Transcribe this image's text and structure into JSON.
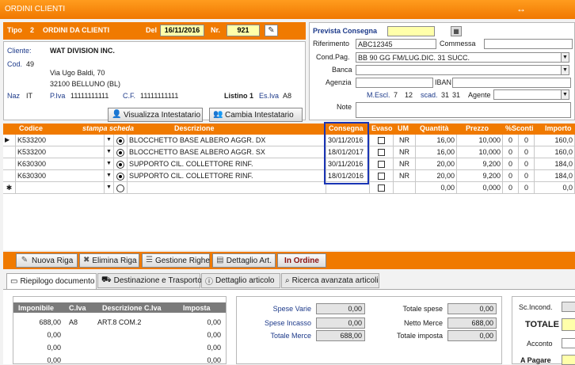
{
  "window": {
    "title": "ORDINI CLIENTI",
    "control_icon": "↔"
  },
  "header": {
    "tipo_label": "Tipo",
    "tipo_value": "2",
    "tipo_desc": "ORDINI DA CLIENTI",
    "del_label": "Del",
    "del_value": "16/11/2016",
    "nr_label": "Nr.",
    "nr_value": "921"
  },
  "cliente": {
    "cliente_label": "Cliente:",
    "name": "WAT DIVISION INC.",
    "cod_label": "Cod.",
    "cod_value": "49",
    "address1": "Via Ugo Baldi, 70",
    "address2": "32100 BELLUNO (BL)",
    "naz_label": "Naz",
    "naz_value": "IT",
    "piva_label": "P.Iva",
    "piva_value": "11111111111",
    "cf_label": "C.F.",
    "cf_value": "11111111111",
    "listino_label": "Listino",
    "listino_value": "1",
    "esiva_label": "Es.Iva",
    "esiva_value": "A8",
    "btn_visualizza": "Visualizza Intestatario",
    "btn_cambia": "Cambia Intestatario"
  },
  "right_panel": {
    "prevista_label": "Prevista Consegna",
    "prevista_value": "",
    "riferimento_label": "Riferimento",
    "riferimento_value": "ABC12345",
    "commessa_label": "Commessa",
    "commessa_value": "",
    "condpag_label": "Cond.Pag.",
    "condpag_value": "BB 90 GG FM/LUG.DIC. 31 SUCC.",
    "banca_label": "Banca",
    "banca_value": "",
    "agenzia_label": "Agenzia",
    "agenzia_value": "",
    "iban_label": "IBAN",
    "iban_value": "",
    "mescl_label": "M.Escl.",
    "mescl_value1": "7",
    "mescl_value2": "12",
    "scad_label": "scad.",
    "scad_value1": "31",
    "scad_value2": "31",
    "agente_label": "Agente",
    "agente_value": "",
    "note_label": "Note",
    "note_value": ""
  },
  "grid": {
    "columns": [
      "Codice",
      "stampa scheda",
      "Descrizione",
      "Consegna",
      "Evaso",
      "UM",
      "Quantità",
      "Prezzo",
      "%Sconti",
      "Importo"
    ],
    "rows": [
      {
        "codice": "K533200",
        "descrizione": "BLOCCHETTO BASE ALBERO AGGR. DX",
        "consegna": "30/11/2016",
        "um": "NR",
        "quantita": "16,00",
        "prezzo": "10,000",
        "sc1": "0",
        "sc2": "0",
        "importo": "160,0"
      },
      {
        "codice": "K533200",
        "descrizione": "BLOCCHETTO BASE ALBERO AGGR. SX",
        "consegna": "18/01/2017",
        "um": "NR",
        "quantita": "16,00",
        "prezzo": "10,000",
        "sc1": "0",
        "sc2": "0",
        "importo": "160,0"
      },
      {
        "codice": "K630300",
        "descrizione": "SUPPORTO CIL. COLLETTORE RINF.",
        "consegna": "30/11/2016",
        "um": "NR",
        "quantita": "20,00",
        "prezzo": "9,200",
        "sc1": "0",
        "sc2": "0",
        "importo": "184,0"
      },
      {
        "codice": "K630300",
        "descrizione": "SUPPORTO CIL. COLLETTORE RINF.",
        "consegna": "18/01/2016",
        "um": "NR",
        "quantita": "20,00",
        "prezzo": "9,200",
        "sc1": "0",
        "sc2": "0",
        "importo": "184,0"
      }
    ],
    "new_row": {
      "marker": "✱",
      "quantita": "0,00",
      "prezzo": "0,000",
      "sc1": "0",
      "sc2": "0",
      "importo": "0,0"
    },
    "current_marker": "▶"
  },
  "actions": {
    "nuova_riga": "Nuova Riga",
    "elimina_riga": "Elimina Riga",
    "gestione_righe": "Gestione Righe",
    "dettaglio_art": "Dettaglio Art.",
    "in_ordine": "In Ordine"
  },
  "tabs": [
    "Riepilogo documento",
    "Destinazione e Trasporto",
    "Dettaglio articolo",
    "Ricerca avanzata articoli"
  ],
  "iva_table": {
    "columns": [
      "Imponibile",
      "C.Iva",
      "Descrizione C.Iva",
      "Imposta"
    ],
    "rows": [
      {
        "imponibile": "688,00",
        "civa": "A8",
        "descrizione": "ART.8 COM.2",
        "imposta": "0,00"
      },
      {
        "imponibile": "0,00",
        "civa": "",
        "descrizione": "",
        "imposta": "0,00"
      },
      {
        "imponibile": "0,00",
        "civa": "",
        "descrizione": "",
        "imposta": "0,00"
      },
      {
        "imponibile": "0,00",
        "civa": "",
        "descrizione": "",
        "imposta": "0,00"
      }
    ]
  },
  "totals": {
    "spese_varie_label": "Spese Varie",
    "spese_varie_value": "0,00",
    "spese_incasso_label": "Spese Incasso",
    "spese_incasso_value": "0,00",
    "totale_merce_label": "Totale Merce",
    "totale_merce_value": "688,00",
    "totale_spese_label": "Totale spese",
    "totale_spese_value": "0,00",
    "netto_merce_label": "Netto Merce",
    "netto_merce_value": "688,00",
    "totale_imposta_label": "Totale imposta",
    "totale_imposta_value": "0,00",
    "sc_incond_label": "Sc.Incond.",
    "totale_label": "TOTALE",
    "acconto_label": "Acconto",
    "a_pagare_label": "A Pagare"
  },
  "colors": {
    "orange": "#f07a00",
    "highlight_border": "#1a35b5",
    "yellow_field": "#ffffaa"
  }
}
